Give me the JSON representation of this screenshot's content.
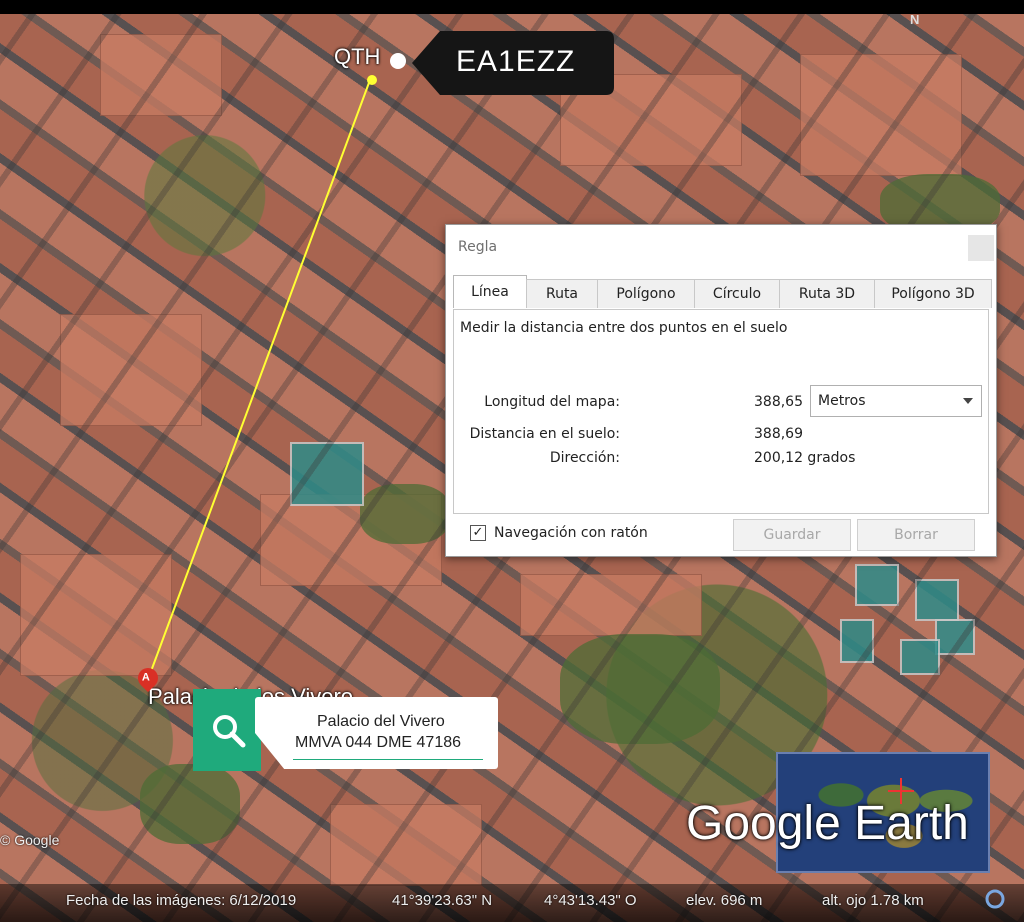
{
  "map": {
    "start_label": "QTH",
    "end_label": "Palacio de los Vivero",
    "end_pin_letter": "A",
    "north_label": "N",
    "callsign": "EA1EZZ",
    "line_color": "#ffff33"
  },
  "ruler": {
    "title": "Regla",
    "tabs": [
      {
        "label": "Línea",
        "active": true
      },
      {
        "label": "Ruta",
        "active": false
      },
      {
        "label": "Polígono",
        "active": false
      },
      {
        "label": "Círculo",
        "active": false
      },
      {
        "label": "Ruta 3D",
        "active": false
      },
      {
        "label": "Polígono 3D",
        "active": false
      }
    ],
    "description": "Medir la distancia entre dos puntos en el suelo",
    "map_length_label": "Longitud del mapa:",
    "map_length_value": "388,65",
    "unit_selected": "Metros",
    "ground_distance_label": "Distancia en el suelo:",
    "ground_distance_value": "388,69",
    "heading_label": "Dirección:",
    "heading_value": "200,12 grados",
    "mouse_nav_label": "Navegación con ratón",
    "mouse_nav_checked": "✓",
    "save_label": "Guardar",
    "clear_label": "Borrar"
  },
  "search_card": {
    "line1": "Palacio del Vivero",
    "line2": "MMVA 044 DME 47186",
    "accent": "#1faa7c"
  },
  "logo": {
    "text": "Google Earth",
    "copyright": "© Google"
  },
  "status": {
    "imagery_date": "Fecha de las imágenes: 6/12/2019",
    "lat": "41°39'23.63\" N",
    "lon": "4°43'13.43\" O",
    "elev": "elev.   696 m",
    "eye_alt": "alt. ojo   1.78 km"
  }
}
